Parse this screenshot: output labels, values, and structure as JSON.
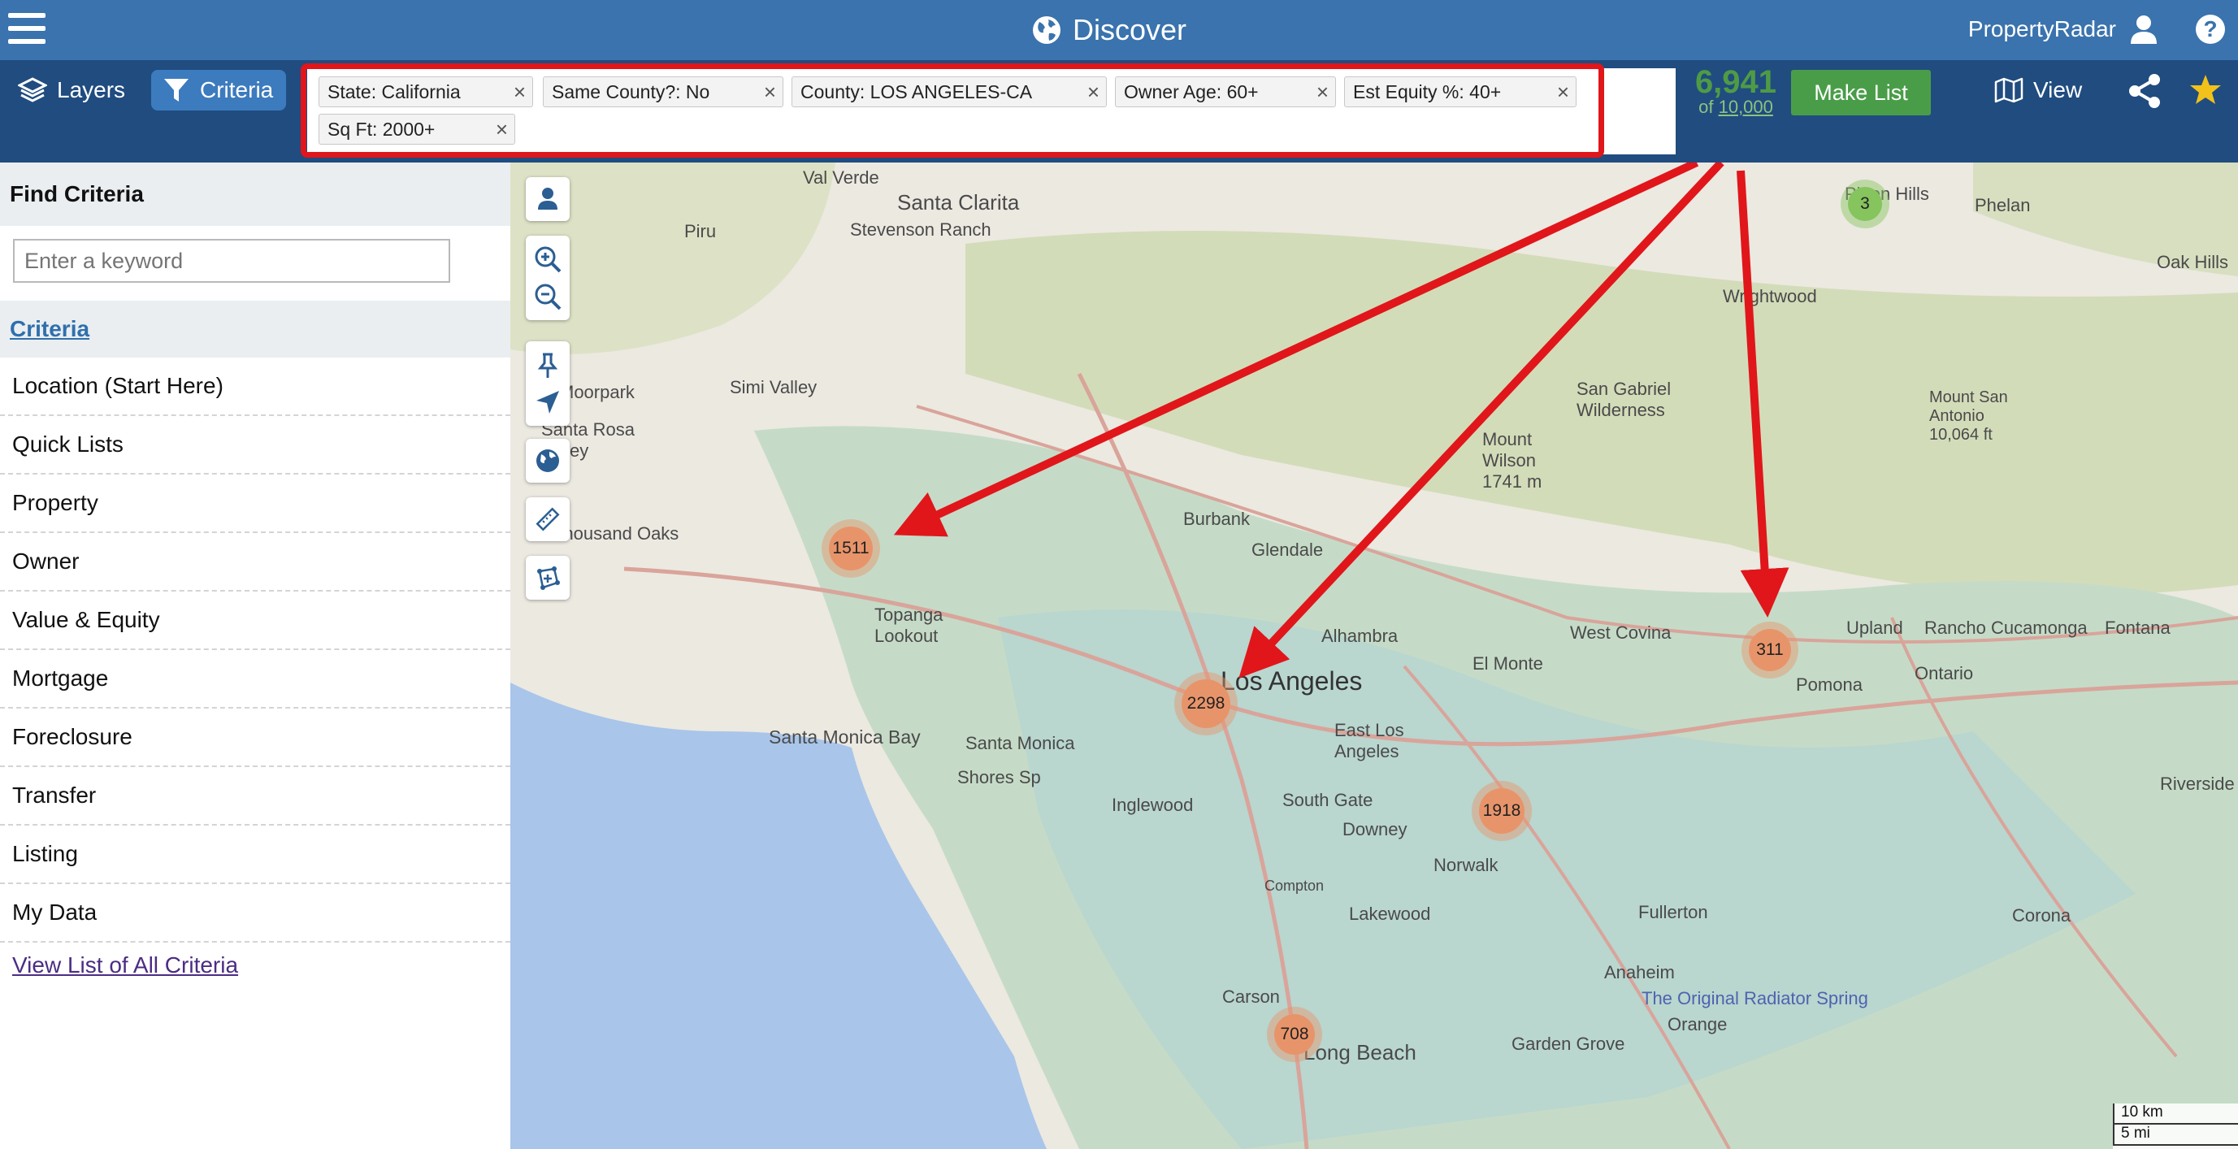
{
  "topbar": {
    "title": "Discover",
    "brand": "PropertyRadar",
    "menu_icon": "hamburger-icon",
    "title_icon": "globe-icon",
    "user_icon": "user-icon",
    "help_icon": "help-icon",
    "help_glyph": "?",
    "color": "#3a73ad"
  },
  "toolbar": {
    "layers_label": "Layers",
    "criteria_label": "Criteria",
    "view_label": "View",
    "make_list_label": "Make List",
    "count": "6,941",
    "count_of": "of",
    "count_total": "10,000",
    "color": "#204c80"
  },
  "filters": [
    {
      "label": "State: California"
    },
    {
      "label": "Same County?: No"
    },
    {
      "label": "County: LOS ANGELES-CA"
    },
    {
      "label": "Owner Age: 60+"
    },
    {
      "label": "Est Equity %: 40+"
    },
    {
      "label": "Sq Ft: 2000+"
    }
  ],
  "sidebar": {
    "title": "Find Criteria",
    "search_placeholder": "Enter a keyword",
    "criteria_link": "Criteria",
    "categories": [
      "Location (Start Here)",
      "Quick Lists",
      "Property",
      "Owner",
      "Value & Equity",
      "Mortgage",
      "Foreclosure",
      "Transfer",
      "Listing",
      "My Data"
    ],
    "view_all": "View List of All Criteria"
  },
  "map": {
    "clusters": [
      "1511",
      "2298",
      "311",
      "1918",
      "708",
      "3"
    ],
    "places": [
      "Val Verde",
      "Santa Clarita",
      "Stevenson Ranch",
      "Piru",
      "Moorpark",
      "Simi Valley",
      "Santa Rosa Valley",
      "Thousand Oaks",
      "Burbank",
      "Glendale",
      "Los Angeles",
      "East Los Angeles",
      "Santa Monica Bay",
      "Santa Monica",
      "Shores Sp",
      "Topanga Lookout",
      "Inglewood",
      "South Gate",
      "Downey",
      "Norwalk",
      "Lakewood",
      "Carson",
      "Long Beach",
      "Garden Grove",
      "Anaheim",
      "Orange",
      "Fullerton",
      "El Monte",
      "West Covina",
      "Pomona",
      "Upland",
      "Rancho Cucamonga",
      "Fontana",
      "Ontario",
      "Corona",
      "Riverside",
      "San Gabriel Wilderness",
      "Mount Wilson 1741 m",
      "Mount San Antonio 10,064 ft",
      "Wrightwood",
      "Pinon Hills",
      "Phelan",
      "Oak Hills",
      "Alhambra",
      "Compton",
      "The Original Radiator Spring"
    ],
    "scale_km": "10 km",
    "scale_mi": "5 mi"
  }
}
